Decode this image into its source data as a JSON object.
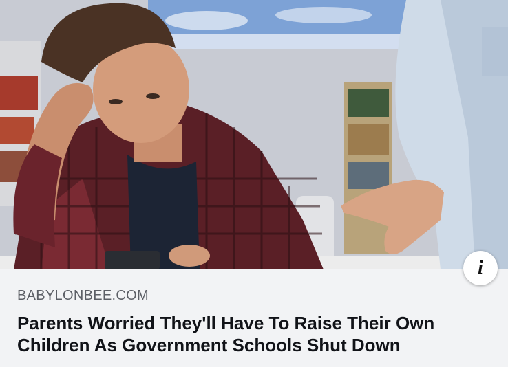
{
  "link_preview": {
    "image_alt": "Teen boy at desk looking at phone while adult gestures beside him",
    "info_icon": "info-icon",
    "source": "BABYLONBEE.COM",
    "headline": "Parents Worried They'll Have To Raise Their Own Children As Government Schools Shut Down"
  },
  "colors": {
    "card_background": "#f2f3f5",
    "source_text": "#5c5f66",
    "headline_text": "#111318",
    "info_button": "#ffffff"
  }
}
